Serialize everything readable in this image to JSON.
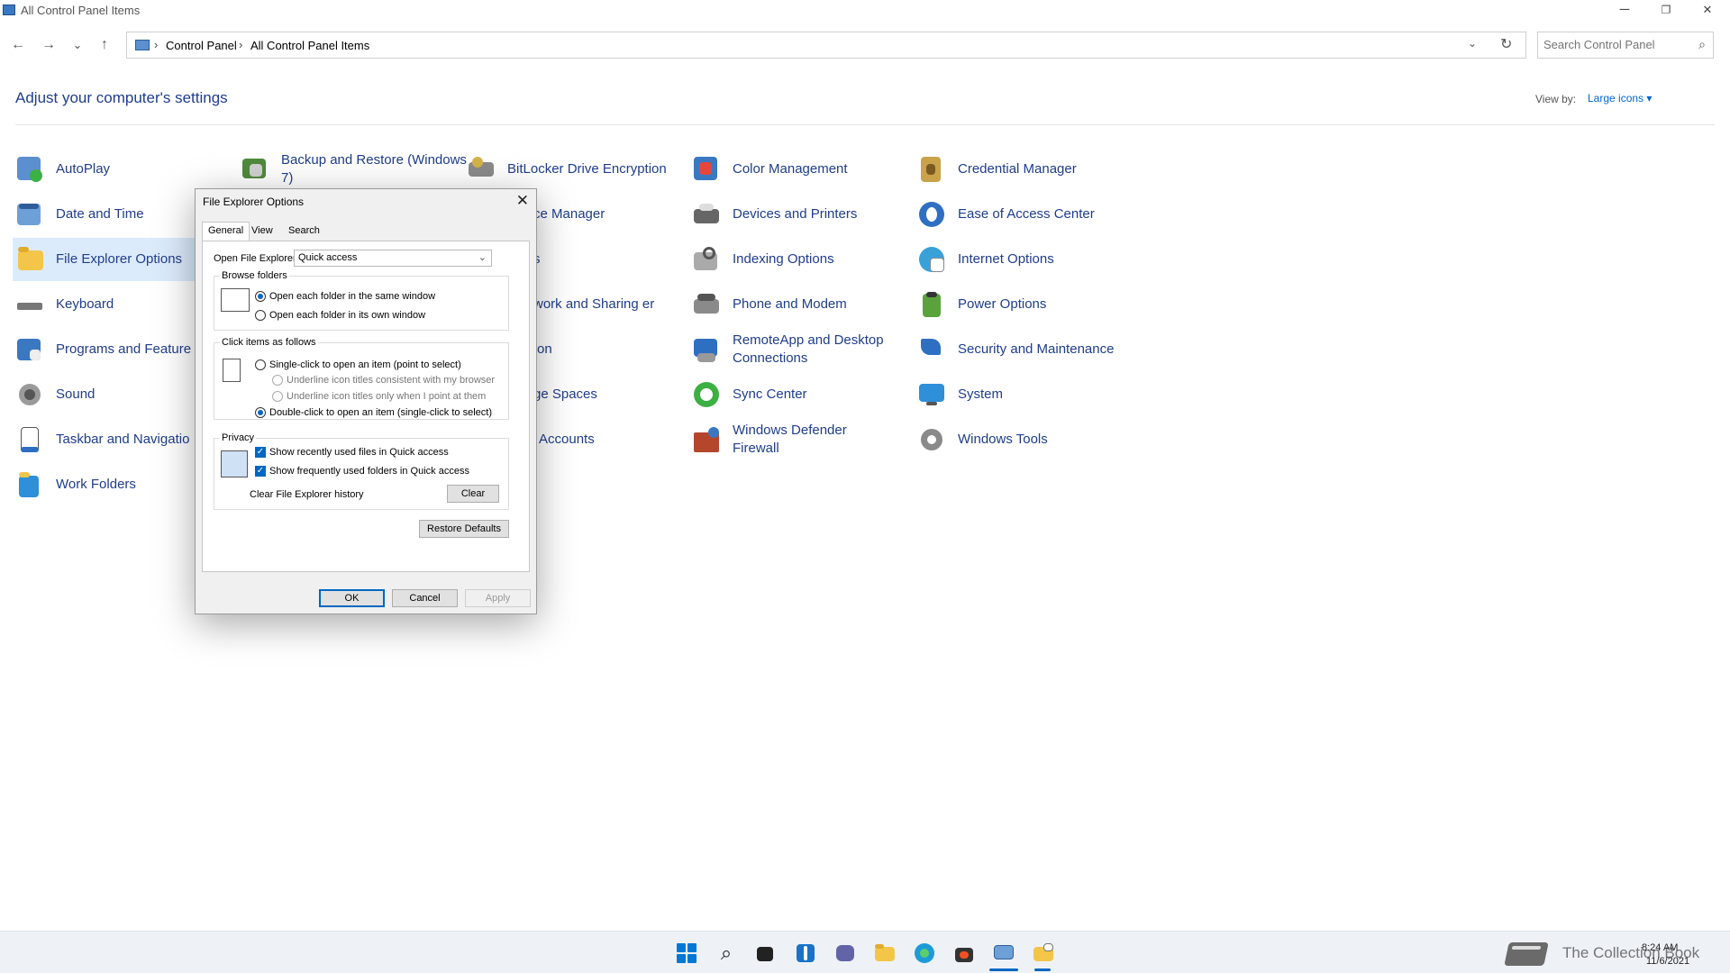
{
  "window": {
    "title": "All Control Panel Items",
    "minimize": "─",
    "restore": "❐",
    "close": "✕"
  },
  "nav": {
    "back": "←",
    "forward": "→",
    "recent": "⌄",
    "up": "↑"
  },
  "address": {
    "separator": "›",
    "crumbs": [
      "Control Panel",
      "All Control Panel Items"
    ],
    "dropdown": "⌄",
    "refresh": "↻"
  },
  "search": {
    "placeholder": "Search Control Panel",
    "icon": "⌕"
  },
  "header": {
    "title": "Adjust your computer's settings",
    "view_by_label": "View by:",
    "view_by_value": "Large icons ▾"
  },
  "items": [
    {
      "label": "AutoPlay"
    },
    {
      "label": "Backup and Restore (Windows 7)"
    },
    {
      "label": "BitLocker Drive Encryption"
    },
    {
      "label": "Color Management"
    },
    {
      "label": "Credential Manager"
    },
    {
      "label": "Date and Time"
    },
    {
      "label": "ce Manager"
    },
    {
      "label": "Devices and Printers"
    },
    {
      "label": "Ease of Access Center"
    },
    {
      "label": "File Explorer Options"
    },
    {
      "label": "s"
    },
    {
      "label": "Indexing Options"
    },
    {
      "label": "Internet Options"
    },
    {
      "label": "Keyboard"
    },
    {
      "label": "work and Sharing er"
    },
    {
      "label": "Phone and Modem"
    },
    {
      "label": "Power Options"
    },
    {
      "label": "Programs and Feature"
    },
    {
      "label": "on"
    },
    {
      "label": "RemoteApp and Desktop Connections"
    },
    {
      "label": "Security and Maintenance"
    },
    {
      "label": "Sound"
    },
    {
      "label": "ge Spaces"
    },
    {
      "label": "Sync Center"
    },
    {
      "label": "System"
    },
    {
      "label": "Taskbar and Navigatio"
    },
    {
      "label": "Accounts"
    },
    {
      "label": "Windows Defender Firewall"
    },
    {
      "label": "Windows Tools"
    },
    {
      "label": "Work Folders"
    }
  ],
  "dialog": {
    "title": "File Explorer Options",
    "close": "✕",
    "tabs": [
      "General",
      "View",
      "Search"
    ],
    "open_to_label": "Open File Explorer to:",
    "open_to_value": "Quick access",
    "browse_group": "Browse folders",
    "browse_same": "Open each folder in the same window",
    "browse_own": "Open each folder in its own window",
    "click_group": "Click items as follows",
    "single_click": "Single-click to open an item (point to select)",
    "underline_browser": "Underline icon titles consistent with my browser",
    "underline_point": "Underline icon titles only when I point at them",
    "double_click": "Double-click to open an item (single-click to select)",
    "privacy_group": "Privacy",
    "recent_files": "Show recently used files in Quick access",
    "frequent_folders": "Show frequently used folders in Quick access",
    "clear_history_label": "Clear File Explorer history",
    "clear_button": "Clear",
    "restore_button": "Restore Defaults",
    "ok": "OK",
    "cancel": "Cancel",
    "apply": "Apply"
  },
  "taskbar": {
    "watermark": "The Collection Book",
    "time": "8:24 AM",
    "date": "11/6/2021"
  }
}
